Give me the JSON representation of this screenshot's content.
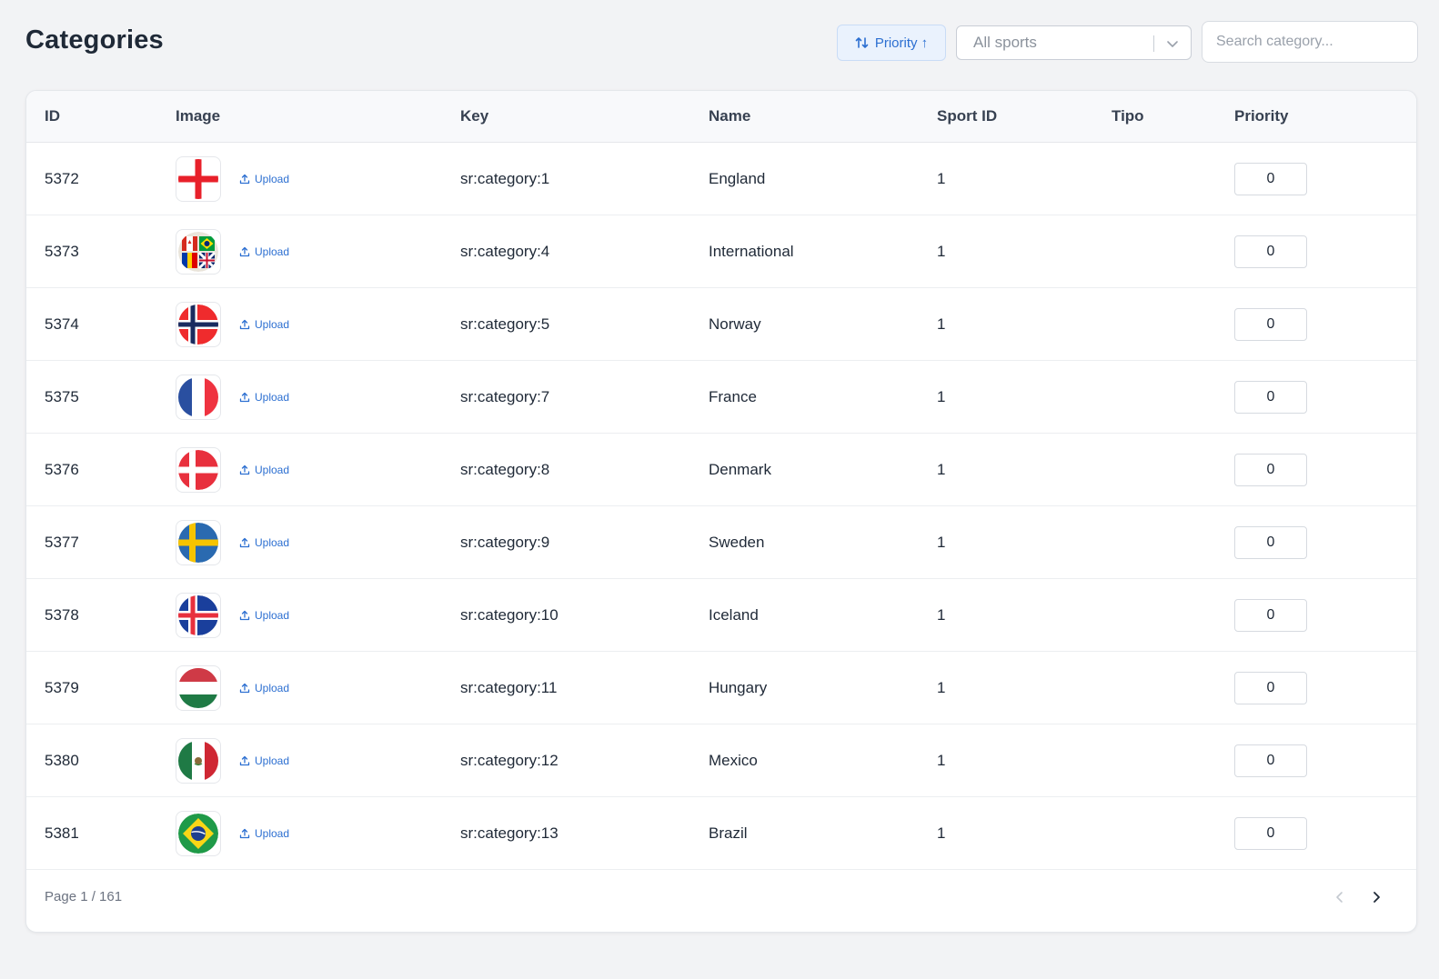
{
  "header": {
    "title": "Categories",
    "sort_button_label": "Priority ↑",
    "sport_select_value": "All sports",
    "search_placeholder": "Search category..."
  },
  "table": {
    "columns": [
      "ID",
      "Image",
      "Key",
      "Name",
      "Sport ID",
      "Tipo",
      "Priority"
    ],
    "upload_label": "Upload",
    "rows": [
      {
        "id": "5372",
        "flag": "england-flag-icon",
        "key": "sr:category:1",
        "name": "England",
        "sport_id": "1",
        "tipo": "",
        "priority": "0"
      },
      {
        "id": "5373",
        "flag": "international-flags-icon",
        "key": "sr:category:4",
        "name": "International",
        "sport_id": "1",
        "tipo": "",
        "priority": "0"
      },
      {
        "id": "5374",
        "flag": "norway-flag-icon",
        "key": "sr:category:5",
        "name": "Norway",
        "sport_id": "1",
        "tipo": "",
        "priority": "0"
      },
      {
        "id": "5375",
        "flag": "france-flag-icon",
        "key": "sr:category:7",
        "name": "France",
        "sport_id": "1",
        "tipo": "",
        "priority": "0"
      },
      {
        "id": "5376",
        "flag": "denmark-flag-icon",
        "key": "sr:category:8",
        "name": "Denmark",
        "sport_id": "1",
        "tipo": "",
        "priority": "0"
      },
      {
        "id": "5377",
        "flag": "sweden-flag-icon",
        "key": "sr:category:9",
        "name": "Sweden",
        "sport_id": "1",
        "tipo": "",
        "priority": "0"
      },
      {
        "id": "5378",
        "flag": "iceland-flag-icon",
        "key": "sr:category:10",
        "name": "Iceland",
        "sport_id": "1",
        "tipo": "",
        "priority": "0"
      },
      {
        "id": "5379",
        "flag": "hungary-flag-icon",
        "key": "sr:category:11",
        "name": "Hungary",
        "sport_id": "1",
        "tipo": "",
        "priority": "0"
      },
      {
        "id": "5380",
        "flag": "mexico-flag-icon",
        "key": "sr:category:12",
        "name": "Mexico",
        "sport_id": "1",
        "tipo": "",
        "priority": "0"
      },
      {
        "id": "5381",
        "flag": "brazil-flag-icon",
        "key": "sr:category:13",
        "name": "Brazil",
        "sport_id": "1",
        "tipo": "",
        "priority": "0"
      }
    ]
  },
  "pagination": {
    "page_text": "Page 1 / 161"
  },
  "colors": {
    "accent": "#2c6fd1",
    "background": "#f2f3f5",
    "card": "#ffffff"
  }
}
